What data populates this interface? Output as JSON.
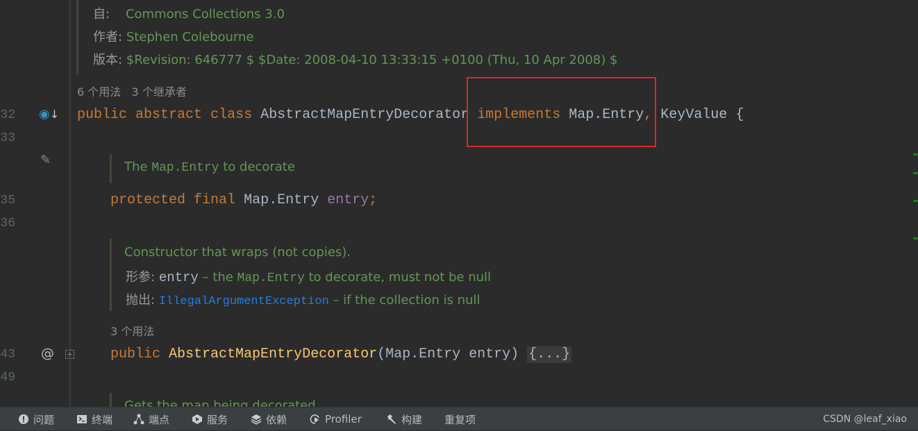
{
  "editor": {
    "doc_header": {
      "since_label": "自:",
      "since_value": "Commons Collections 3.0",
      "author_label": "作者:",
      "author_value": "Stephen Colebourne",
      "version_label": "版本:",
      "version_value": "$Revision: 646777 $ $Date: 2008-04-10 13:33:15 +0100 (Thu, 10 Apr 2008) $"
    },
    "class_hints": {
      "usages": "6 个用法",
      "inheritors": "3 个继承者"
    },
    "line_numbers": [
      "32",
      "33",
      "35",
      "36",
      "43",
      "49"
    ],
    "class_decl": {
      "kw1": "public",
      "kw2": "abstract",
      "kw3": "class",
      "name": "AbstractMapEntryDecorator",
      "kw4": "implements",
      "iface1": "Map.Entry",
      "comma": ",",
      "iface2": "KeyValue",
      "brace": "{"
    },
    "field_doc": {
      "pre": "The ",
      "code": "Map.Entry",
      "post": " to decorate"
    },
    "field_decl": {
      "kw1": "protected",
      "kw2": "final",
      "type": "Map.Entry",
      "name": "entry",
      "semi": ";"
    },
    "ctor_doc": {
      "summary": "Constructor that wraps (not copies).",
      "param_label": "形参:",
      "param_name": "entry",
      "param_dash": " – the ",
      "param_code": "Map.Entry",
      "param_post": " to decorate, must not be null",
      "throws_label": "抛出:",
      "throws_type": "IllegalArgumentException",
      "throws_post": " – if the collection is null"
    },
    "ctor_hints": {
      "usages": "3 个用法"
    },
    "ctor_decl": {
      "kw": "public",
      "name": "AbstractMapEntryDecorator",
      "params": "(Map.Entry entry) ",
      "folded": "{...}"
    },
    "next_doc": "Gets the map being decorated",
    "highlight_color": "#e0262b"
  },
  "status_bar": {
    "items": [
      {
        "label": "问题",
        "icon": "exclamation-circle-icon"
      },
      {
        "label": "终端",
        "icon": "terminal-icon"
      },
      {
        "label": "端点",
        "icon": "endpoints-icon"
      },
      {
        "label": "服务",
        "icon": "services-icon"
      },
      {
        "label": "依赖",
        "icon": "layers-icon"
      },
      {
        "label": "Profiler",
        "icon": "profiler-icon"
      },
      {
        "label": "构建",
        "icon": "hammer-icon"
      },
      {
        "label": "重复项",
        "icon": ""
      }
    ],
    "watermark": "CSDN @leaf_xiao"
  }
}
